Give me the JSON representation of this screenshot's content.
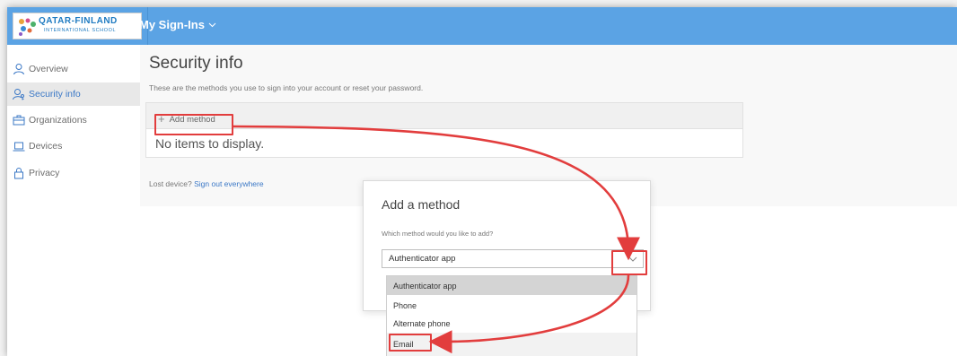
{
  "logo": {
    "title": "QATAR-FINLAND",
    "subtitle": "INTERNATIONAL SCHOOL"
  },
  "header": {
    "app_title": "My Sign-Ins"
  },
  "sidebar": {
    "items": [
      {
        "label": "Overview",
        "icon": "person-icon"
      },
      {
        "label": "Security info",
        "icon": "person-key-icon"
      },
      {
        "label": "Organizations",
        "icon": "briefcase-icon"
      },
      {
        "label": "Devices",
        "icon": "laptop-icon"
      },
      {
        "label": "Privacy",
        "icon": "lock-icon"
      }
    ]
  },
  "main": {
    "title": "Security info",
    "subtitle": "These are the methods you use to sign into your account or reset your password.",
    "add_method_label": "Add method",
    "empty_text": "No items to display.",
    "lost_device_text": "Lost device?",
    "sign_out_link": "Sign out everywhere"
  },
  "dialog": {
    "title": "Add a method",
    "question": "Which method would you like to add?",
    "selected_value": "Authenticator app",
    "options": [
      "Authenticator app",
      "Phone",
      "Alternate phone",
      "Email"
    ]
  },
  "colors": {
    "header_bg": "#5ba3e4",
    "accent": "#3b78c6",
    "highlight": "#e23d3d"
  }
}
